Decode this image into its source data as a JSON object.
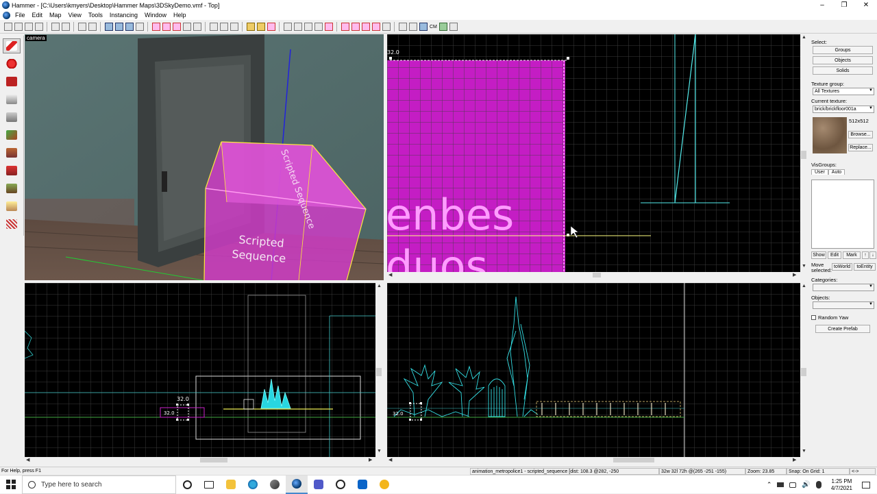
{
  "window": {
    "title": "Hammer - [C:\\Users\\kmyers\\Desktop\\Hammer Maps\\3DSkyDemo.vmf - Top]",
    "minimize": "–",
    "maximize": "❐",
    "close": "✕"
  },
  "menu": [
    "File",
    "Edit",
    "Map",
    "View",
    "Tools",
    "Instancing",
    "Window",
    "Help"
  ],
  "toolbar": {
    "cm_label": "CM"
  },
  "viewports": {
    "camera_label": "camera",
    "top_size_label": "32.0",
    "front_size_label": "32.0",
    "front_mini_label": "32.0",
    "side_size_label": "32.0",
    "brush_text_top": "Scripted Sequence",
    "brush_text_bottom_1": "Scripted",
    "brush_text_bottom_2": "Sequence",
    "top_texture_text_1": "enbes",
    "top_texture_text_2": "duos"
  },
  "right_panel": {
    "select_label": "Select:",
    "groups_button": "Groups",
    "objects_button": "Objects",
    "solids_button": "Solids",
    "texture_group_label": "Texture group:",
    "texture_group_value": "All Textures",
    "current_texture_label": "Current texture:",
    "current_texture_value": "brick/brickfloor001a",
    "texture_size": "512x512",
    "browse_button": "Browse...",
    "replace_button": "Replace...",
    "visgroups_label": "VisGroups:",
    "tab_user": "User",
    "tab_auto": "Auto",
    "show_button": "Show",
    "edit_button": "Edit",
    "mark_button": "Mark",
    "up_button": "↑",
    "down_button": "↓",
    "move_selected_label": "Move selected:",
    "to_world_button": "toWorld",
    "to_entity_button": "toEntity",
    "categories_label": "Categories:",
    "objects_label": "Objects:",
    "random_yaw_label": "Random Yaw",
    "create_prefab_button": "Create Prefab"
  },
  "status": {
    "help": "For Help, press F1",
    "selection": "animation_metropolice1 - scripted_sequence  [dist: 108.3  @282, -250",
    "size": "32w 32l 72h @(265 -251 -155)",
    "zoom": "Zoom: 23.85",
    "snap": "Snap: On Grid: 1",
    "extra": "<->"
  },
  "taskbar": {
    "search_placeholder": "Type here to search",
    "time": "1:25 PM",
    "date": "4/7/2021"
  }
}
